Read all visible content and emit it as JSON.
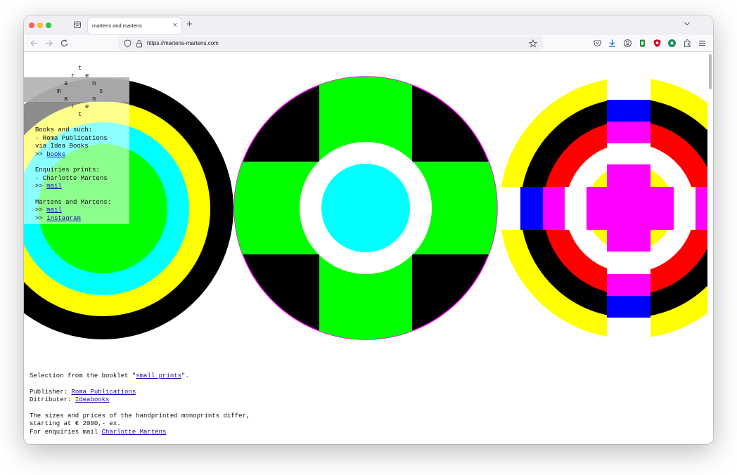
{
  "browser": {
    "tab_title": "martens and martens",
    "tab_close": "×",
    "new_tab": "+",
    "url": "https://martens-martens.com"
  },
  "logo": {
    "letters": [
      "t",
      "r",
      "e",
      "a",
      "n",
      "m",
      "s",
      "a",
      "n",
      "r",
      "e",
      "t"
    ]
  },
  "panel": {
    "books_heading": "Books and such:",
    "books_line1": "- Roma Publications",
    "books_line2": "via Idea Books",
    "books_prefix": ">> ",
    "books_link": "books",
    "prints_heading": "Enquiries prints:",
    "prints_line1": "- Charlotte Martens",
    "prints_prefix": ">> ",
    "prints_link": "mail",
    "mm_heading": "Martens and Martens:",
    "mm_prefix1": ">> ",
    "mm_link_mail": "mail",
    "mm_prefix2": ">> ",
    "mm_link_instagram": "instagram"
  },
  "info": {
    "selection_pre": "Selection from the booklet \"",
    "selection_link": "small prints",
    "selection_post": "\".",
    "publisher_label": "Publisher: ",
    "publisher_link": "Roma Publications",
    "distributor_label": "Ditributer: ",
    "distributor_link": "Ideabooks",
    "sizes_line1": "The sizes and prices of the handprinted monoprints differ,",
    "sizes_line2": "starting at € 2000,- ex.",
    "enquiries_label": "For enquiries mail ",
    "enquiries_link": "Charlotte Martens"
  },
  "colors": {
    "green": "#00ff00",
    "cyan": "#00ffff",
    "yellow": "#ffff00",
    "magenta": "#ff00ff",
    "red": "#ff0000",
    "blue": "#0000ff",
    "black": "#000000",
    "link": "#1a0dab"
  },
  "icons": [
    "tabs-icon",
    "back-arrow-icon",
    "forward-arrow-icon",
    "reload-icon",
    "shield-icon",
    "lock-icon",
    "star-icon",
    "pocket-icon",
    "download-icon",
    "account-icon",
    "extension-icon",
    "extensions-puzzle-icon",
    "menu-icon"
  ]
}
